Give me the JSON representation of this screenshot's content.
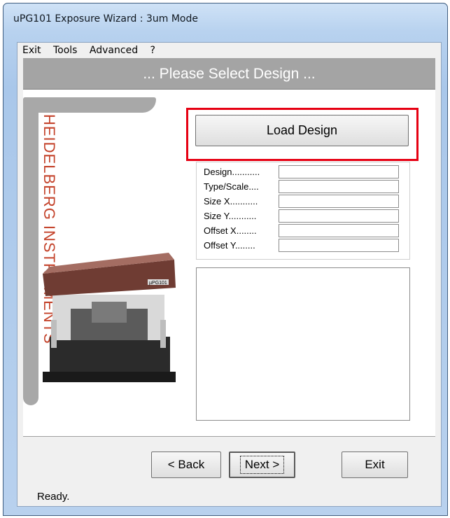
{
  "window": {
    "title": "uPG101 Exposure Wizard : 3um Mode"
  },
  "menu": {
    "items": [
      "Exit",
      "Tools",
      "Advanced",
      "?"
    ]
  },
  "header": {
    "title": "... Please Select Design ..."
  },
  "logo": {
    "text": "HEIDELBERG INSTRUMENTS",
    "machine_label": "µPG101"
  },
  "design": {
    "load_button": "Load Design",
    "fields": [
      {
        "label": "Design...........",
        "value": ""
      },
      {
        "label": "Type/Scale....",
        "value": ""
      },
      {
        "label": "Size X...........",
        "value": ""
      },
      {
        "label": "Size Y...........",
        "value": ""
      },
      {
        "label": "Offset X........",
        "value": ""
      },
      {
        "label": "Offset Y........",
        "value": ""
      }
    ],
    "notes_text": ""
  },
  "nav": {
    "back_label": "< Back",
    "next_label": "Next >",
    "exit_label": "Exit"
  },
  "status": {
    "text": "Ready."
  },
  "colors": {
    "highlight": "#e60012",
    "logo": "#c4432b"
  }
}
